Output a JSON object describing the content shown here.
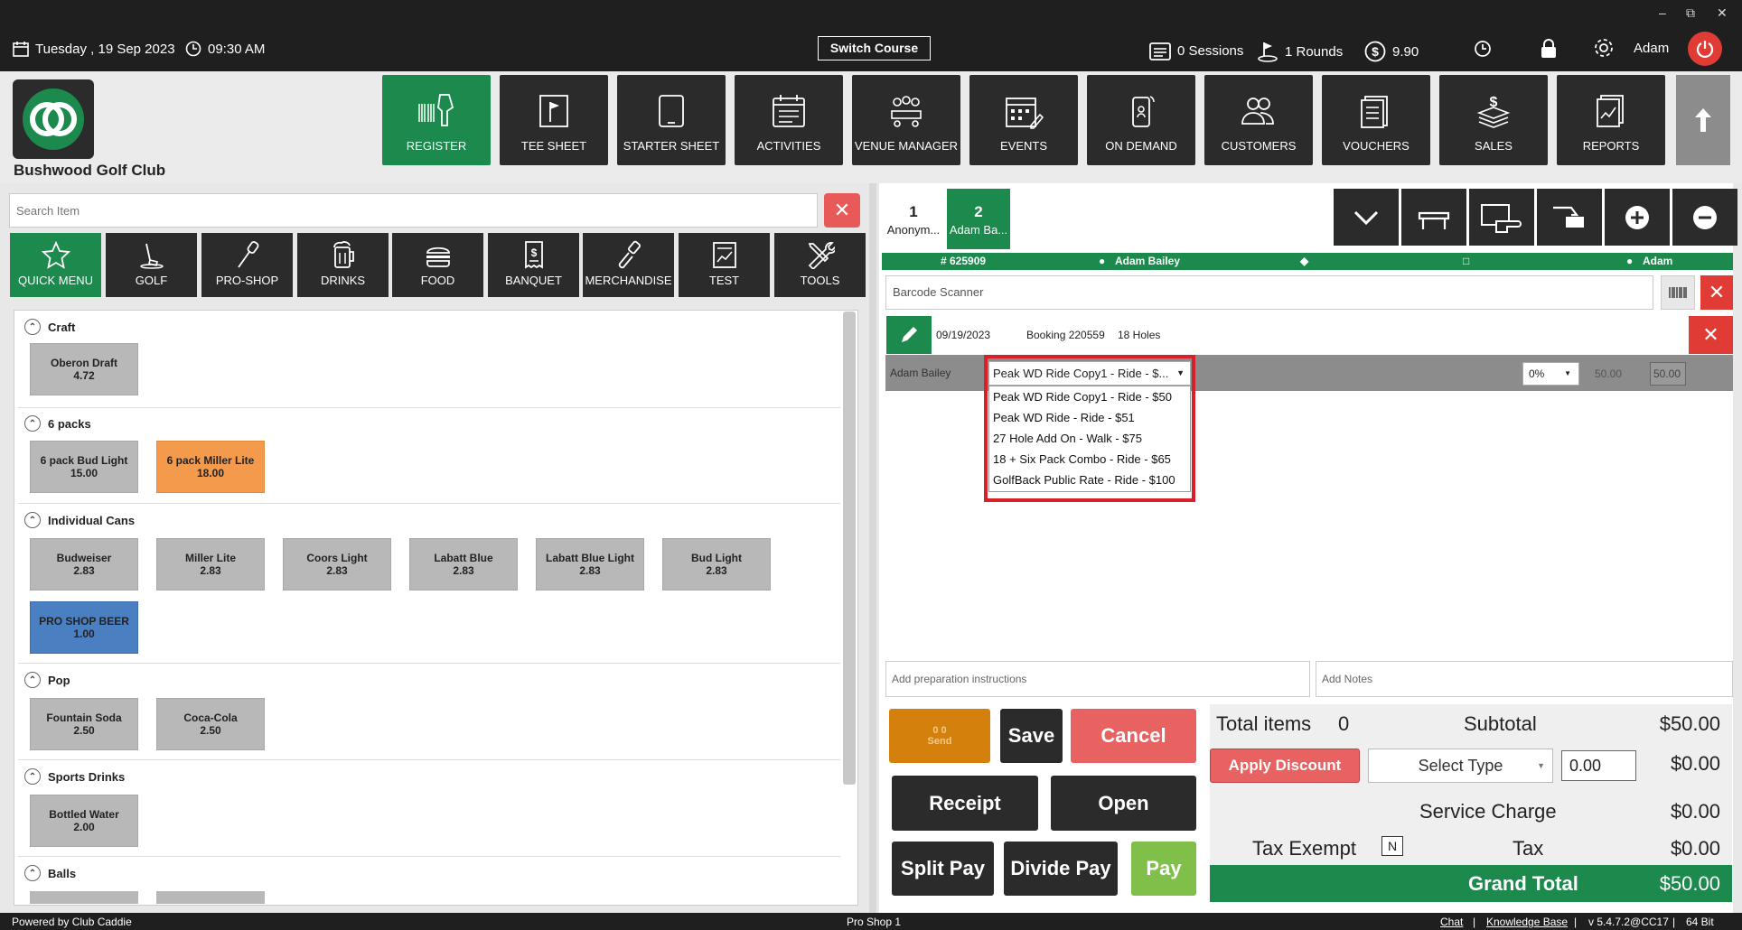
{
  "topbar": {
    "date": "Tuesday , 19 Sep 2023",
    "time": "09:30 AM",
    "switch_course": "Switch Course",
    "sessions": "0 Sessions",
    "rounds": "1 Rounds",
    "balance": "9.90",
    "user": "Adam"
  },
  "club_name": "Bushwood Golf Club",
  "nav": [
    {
      "label": "REGISTER",
      "icon": "barcode-scanner-icon"
    },
    {
      "label": "TEE SHEET",
      "icon": "flag-icon"
    },
    {
      "label": "STARTER SHEET",
      "icon": "tablet-icon"
    },
    {
      "label": "ACTIVITIES",
      "icon": "calendar-icon"
    },
    {
      "label": "VENUE MANAGER",
      "icon": "meeting-icon"
    },
    {
      "label": "EVENTS",
      "icon": "calendar-edit-icon"
    },
    {
      "label": "ON DEMAND",
      "icon": "mobile-icon"
    },
    {
      "label": "CUSTOMERS",
      "icon": "people-icon"
    },
    {
      "label": "VOUCHERS",
      "icon": "voucher-icon"
    },
    {
      "label": "SALES",
      "icon": "money-stack-icon"
    },
    {
      "label": "REPORTS",
      "icon": "report-icon"
    }
  ],
  "search": {
    "placeholder": "Search Item"
  },
  "categories": [
    {
      "label": "QUICK MENU",
      "icon": "star-icon"
    },
    {
      "label": "GOLF",
      "icon": "golf-icon"
    },
    {
      "label": "PRO-SHOP",
      "icon": "club-icon"
    },
    {
      "label": "DRINKS",
      "icon": "beer-icon"
    },
    {
      "label": "FOOD",
      "icon": "burger-icon"
    },
    {
      "label": "BANQUET",
      "icon": "receipt-icon"
    },
    {
      "label": "MERCHANDISE",
      "icon": "brush-icon"
    },
    {
      "label": "TEST",
      "icon": "chart-icon"
    },
    {
      "label": "TOOLS",
      "icon": "tools-icon"
    }
  ],
  "sections": [
    {
      "title": "Craft",
      "items": [
        {
          "name": "Oberon Draft",
          "price": "4.72",
          "color": "#b8b8b8"
        }
      ]
    },
    {
      "title": "6 packs",
      "items": [
        {
          "name": "6 pack Bud Light",
          "price": "15.00",
          "color": "#b8b8b8"
        },
        {
          "name": "6 pack Miller Lite",
          "price": "18.00",
          "color": "#f39a4c"
        }
      ]
    },
    {
      "title": "Individual Cans",
      "items": [
        {
          "name": "Budweiser",
          "price": "2.83",
          "color": "#b8b8b8"
        },
        {
          "name": "Miller Lite",
          "price": "2.83",
          "color": "#b8b8b8"
        },
        {
          "name": "Coors Light",
          "price": "2.83",
          "color": "#b8b8b8"
        },
        {
          "name": "Labatt Blue",
          "price": "2.83",
          "color": "#b8b8b8"
        },
        {
          "name": "Labatt Blue Light",
          "price": "2.83",
          "color": "#b8b8b8"
        },
        {
          "name": "Bud Light",
          "price": "2.83",
          "color": "#b8b8b8"
        },
        {
          "name": "PRO SHOP BEER",
          "price": "1.00",
          "color": "#4a7fc1"
        }
      ]
    },
    {
      "title": "Pop",
      "items": [
        {
          "name": "Fountain Soda",
          "price": "2.50",
          "color": "#b8b8b8"
        },
        {
          "name": "Coca-Cola",
          "price": "2.50",
          "color": "#b8b8b8"
        }
      ]
    },
    {
      "title": "Sports Drinks",
      "items": [
        {
          "name": "Bottled Water",
          "price": "2.00",
          "color": "#b8b8b8"
        }
      ]
    },
    {
      "title": "Balls",
      "items": []
    }
  ],
  "tabs": [
    {
      "num": "1",
      "name": "Anonym..."
    },
    {
      "num": "2",
      "name": "Adam Ba..."
    }
  ],
  "infobar": {
    "id": "# 625909",
    "customer": "Adam Bailey",
    "assigned": "Adam"
  },
  "barcode": {
    "placeholder": "Barcode Scanner"
  },
  "booking": {
    "date": "09/19/2023",
    "booking": "Booking 220559",
    "holes": "18 Holes"
  },
  "line": {
    "player": "Adam Bailey",
    "selected": "Peak WD Ride Copy1 - Ride - $...",
    "options": [
      "Peak WD Ride Copy1 - Ride - $50",
      "Peak WD Ride - Ride - $51",
      "27 Hole Add On - Walk - $75",
      "18 + Six Pack Combo - Ride - $65",
      "GolfBack Public Rate - Ride - $100"
    ],
    "discount": "0%",
    "price": "50.00",
    "total": "50.00"
  },
  "notes": {
    "prep": "Add preparation instructions",
    "notes": "Add Notes"
  },
  "actions": {
    "send_counts": "0  0",
    "send": "Send",
    "save": "Save",
    "cancel": "Cancel",
    "receipt": "Receipt",
    "open": "Open",
    "split_pay": "Split Pay",
    "divide_pay": "Divide Pay",
    "pay": "Pay"
  },
  "totals": {
    "total_items_label": "Total items",
    "total_items": "0",
    "subtotal_label": "Subtotal",
    "subtotal": "$50.00",
    "apply_discount": "Apply Discount",
    "select_type": "Select Type",
    "discount_value": "0.00",
    "discount_amount": "$0.00",
    "service_charge_label": "Service Charge",
    "service_charge": "$0.00",
    "tax_exempt_label": "Tax Exempt",
    "tax_exempt": "N",
    "tax_label": "Tax",
    "tax": "$0.00",
    "grand_total_label": "Grand Total",
    "grand_total": "$50.00"
  },
  "footer": {
    "powered": "Powered by Club Caddie",
    "station": "Pro Shop 1",
    "chat": "Chat",
    "kb": "Knowledge Base",
    "version": "v 5.4.7.2@CC17",
    "bits": "64 Bit"
  },
  "colors": {
    "green": "#1b8a4c",
    "dark": "#2b2b2b",
    "red": "#e03b34",
    "orange": "#d4800d",
    "pay_green": "#7fbf4a"
  }
}
